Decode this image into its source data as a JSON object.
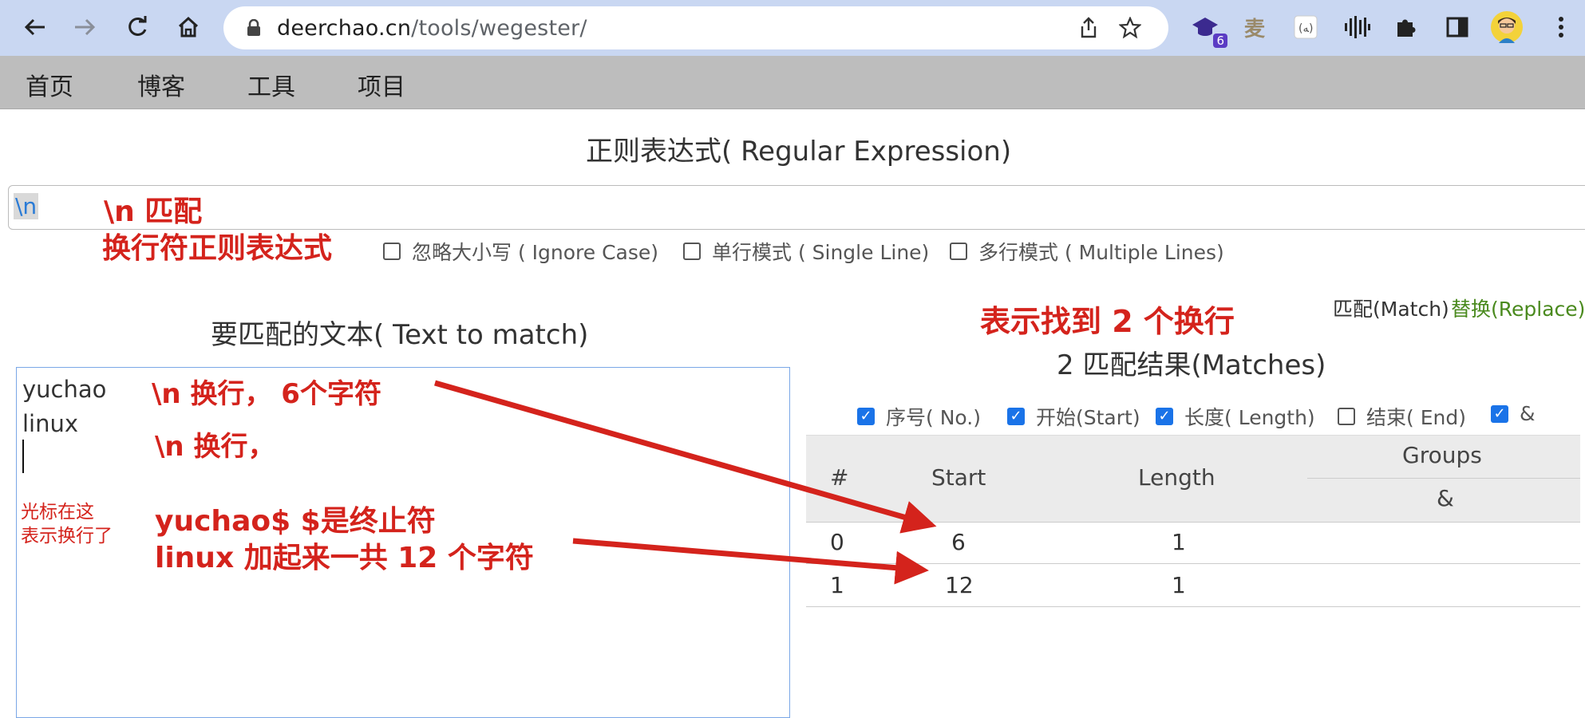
{
  "browser": {
    "url_host": "deerchao.cn",
    "url_path": "/tools/wegester/",
    "extension_badge": "6",
    "extension_text_icon": "麦"
  },
  "site_nav": [
    "首页",
    "博客",
    "工具",
    "项目"
  ],
  "regex_section": {
    "title": "正则表达式( Regular Expression)",
    "pattern": "\\n",
    "options": [
      {
        "label": "忽略大小写 ( Ignore Case)",
        "checked": false
      },
      {
        "label": "单行模式 ( Single Line)",
        "checked": false
      },
      {
        "label": "多行模式 ( Multiple Lines)",
        "checked": false
      }
    ]
  },
  "text_section": {
    "title": "要匹配的文本( Text to match)",
    "lines": [
      "yuchao",
      "linux"
    ]
  },
  "results_section": {
    "mode_match": "匹配(Match)",
    "mode_replace": "替换(Replace)",
    "summary": "2 匹配结果(Matches)",
    "columns": [
      {
        "label": "序号( No.)",
        "checked": true
      },
      {
        "label": "开始(Start)",
        "checked": true
      },
      {
        "label": "长度( Length)",
        "checked": true
      },
      {
        "label": "结束( End)",
        "checked": false
      },
      {
        "label": "&",
        "checked": true
      }
    ],
    "table": {
      "headers": {
        "index": "#",
        "start": "Start",
        "length": "Length",
        "groups": "Groups",
        "amp": "&"
      },
      "rows": [
        {
          "index": "0",
          "start": "6",
          "length": "1"
        },
        {
          "index": "1",
          "start": "12",
          "length": "1"
        }
      ]
    }
  },
  "annotations": {
    "regex_note_1": "\\n 匹配",
    "regex_note_2": "换行符正则表达式",
    "results_note": "表示找到 2 个换行",
    "line1_note": "\\n 换行， 6个字符",
    "line2_note": "\\n 换行，",
    "cursor_note_1": "光标在这",
    "cursor_note_2": "表示换行了",
    "total_note_1": "yuchao$    $是终止符",
    "total_note_2": "linux 加起来一共 12 个字符"
  },
  "colors": {
    "chrome_bg": "#c9d7f2",
    "sitebar_bg": "#bdbdbd",
    "annotation_red": "#d4231c",
    "pattern_blue": "#2a7bd6",
    "replace_green": "#4a8a1e",
    "checkbox_blue": "#1a73e8"
  }
}
